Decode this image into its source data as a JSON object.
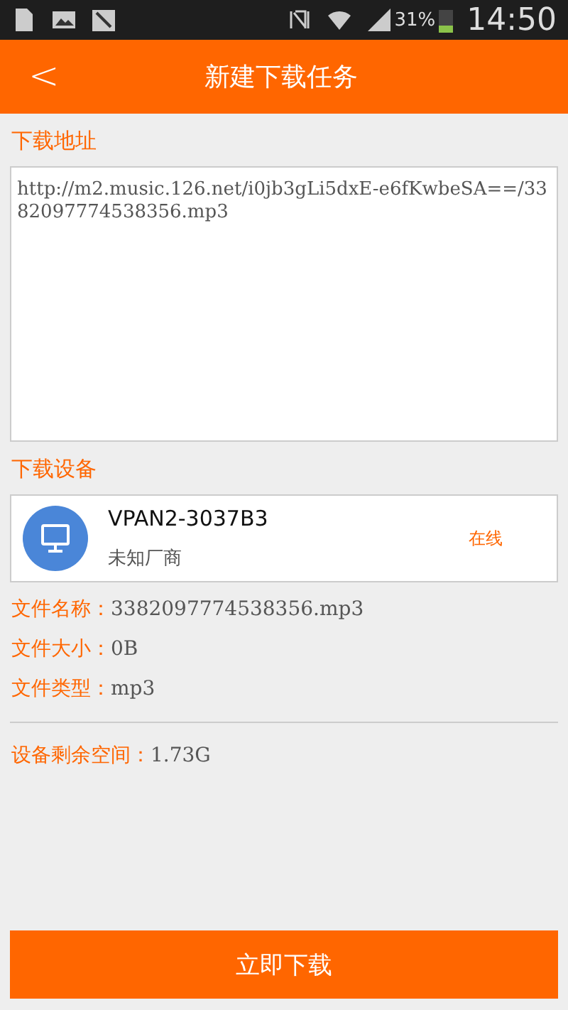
{
  "status_bar": {
    "battery_text": "31%",
    "time": "14:50"
  },
  "header": {
    "back": "<",
    "title": "新建下载任务"
  },
  "url_section": {
    "label": "下载地址",
    "value": "http://m2.music.126.net/i0jb3gLi5dxE-e6fKwbeSA==/3382097774538356.mp3"
  },
  "device_section": {
    "label": "下载设备",
    "device": {
      "name": "VPAN2-3037B3",
      "vendor": "未知厂商",
      "status": "在线"
    }
  },
  "file_info": [
    {
      "label": "文件名称：",
      "value": "3382097774538356.mp3"
    },
    {
      "label": "文件大小：",
      "value": "0B"
    },
    {
      "label": "文件类型：",
      "value": "mp3"
    }
  ],
  "free_space": {
    "label": "设备剩余空间：",
    "value": "1.73G"
  },
  "download_button": "立即下载"
}
